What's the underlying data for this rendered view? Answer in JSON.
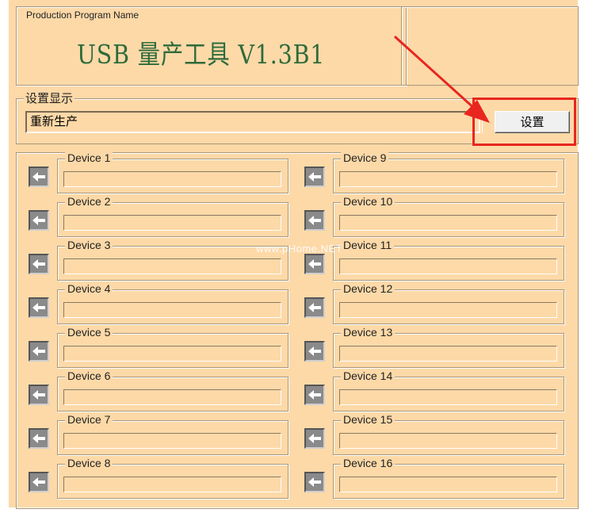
{
  "title_group": {
    "legend": "Production Program Name",
    "title": "USB 量产工具 V1.3B1"
  },
  "settings_display": {
    "legend": "设置显示",
    "value": "重新生产",
    "button_label": "设置"
  },
  "watermark": "www.pHome.NET",
  "devices_left": [
    {
      "label": "Device 1"
    },
    {
      "label": "Device 2"
    },
    {
      "label": "Device 3"
    },
    {
      "label": "Device 4"
    },
    {
      "label": "Device 5"
    },
    {
      "label": "Device 6"
    },
    {
      "label": "Device 7"
    },
    {
      "label": "Device 8"
    }
  ],
  "devices_right": [
    {
      "label": "Device 9"
    },
    {
      "label": "Device 10"
    },
    {
      "label": "Device 11"
    },
    {
      "label": "Device 12"
    },
    {
      "label": "Device 13"
    },
    {
      "label": "Device 14"
    },
    {
      "label": "Device 15"
    },
    {
      "label": "Device 16"
    }
  ],
  "colors": {
    "background": "#fdd9a8",
    "title_text": "#2e6b3b",
    "highlight": "#e8261f"
  },
  "icons": {
    "device_port": "left-arrow-icon",
    "annotation": "red-arrow-icon"
  }
}
